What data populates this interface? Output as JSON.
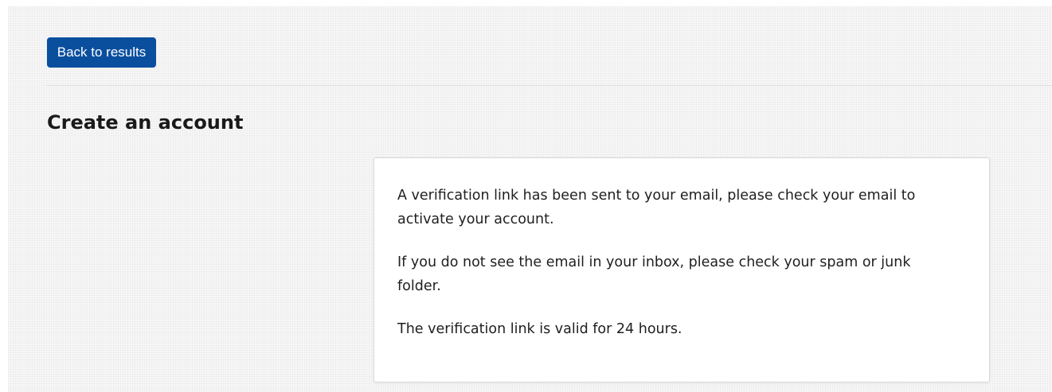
{
  "header": {
    "back_button_label": "Back to results"
  },
  "main": {
    "title": "Create an account",
    "messages": [
      "A verification link has been sent to your email, please check your email to activate your account.",
      "If you do not see the email in your inbox, please check your spam or junk folder.",
      "The verification link is valid for 24 hours."
    ]
  },
  "colors": {
    "primary_button": "#0a4f9e",
    "page_background": "#f7f7f7",
    "card_background": "#ffffff"
  }
}
